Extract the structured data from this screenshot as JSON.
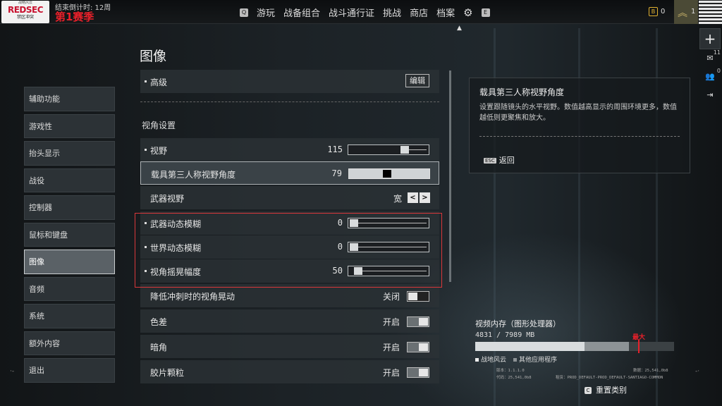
{
  "topbar": {
    "logo_top": "战略风云",
    "logo_main": "REDSEC",
    "logo_sub": "禁区冲突",
    "countdown": "结束倒计时: 12周",
    "season": "第1赛季",
    "nav_left_key": "Q",
    "nav_items": [
      "游玩",
      "战备组合",
      "战斗通行证",
      "挑战",
      "商店",
      "档案"
    ],
    "nav_right_key": "E",
    "currency_icon": "B",
    "currency_value": "0",
    "rank_value": "1"
  },
  "right_column": {
    "plus": "+",
    "mail_count": "11",
    "friends_count": "0"
  },
  "left_menu": [
    {
      "label": "辅助功能",
      "active": false
    },
    {
      "label": "游戏性",
      "active": false
    },
    {
      "label": "抬头显示",
      "active": false
    },
    {
      "label": "战役",
      "active": false
    },
    {
      "label": "控制器",
      "active": false
    },
    {
      "label": "鼠标和键盘",
      "active": false
    },
    {
      "label": "图像",
      "active": true
    },
    {
      "label": "音频",
      "active": false
    },
    {
      "label": "系统",
      "active": false
    },
    {
      "label": "额外内容",
      "active": false
    },
    {
      "label": "退出",
      "active": false
    }
  ],
  "page_title": "图像",
  "settings": {
    "advanced_label": "高级",
    "edit_label": "编辑",
    "section_header": "视角设置",
    "fov_label": "视野",
    "fov_value": "115",
    "fov_level": 0.73,
    "vehicle_fov_label": "载具第三人称视野角度",
    "vehicle_fov_value": "79",
    "vehicle_fov_level": 0.47,
    "weapon_fov_label": "武器视野",
    "weapon_fov_value": "宽",
    "weapon_blur_label": "武器动态模糊",
    "weapon_blur_value": "0",
    "world_blur_label": "世界动态模糊",
    "world_blur_value": "0",
    "camera_shake_label": "视角摇晃幅度",
    "camera_shake_value": "50",
    "sprint_shake_label": "降低冲刺时的视角晃动",
    "sprint_shake_value": "关闭",
    "chromatic_label": "色差",
    "chromatic_value": "开启",
    "vignette_label": "暗角",
    "vignette_value": "开启",
    "grain_label": "胶片颗粒",
    "grain_value": "开启"
  },
  "info_panel": {
    "title": "载具第三人称视野角度",
    "description": "设置跟随镜头的水平视野。数值越高显示的周围环境更多，数值越低则更聚焦和放大。",
    "esc_key": "ESC",
    "back_label": "返回"
  },
  "memory": {
    "title": "视频内存（图形处理器）",
    "usage": "4831 / 7989 MB",
    "max_label": "最大",
    "legend_bf": "战地风云",
    "legend_other": "其他应用程序",
    "version": "版本：1.1.1.0",
    "code": "代码：25,541,0b8",
    "data": "数据：25,541,0b8",
    "rental": "租赁：PROD_DEFAULT-PROD_DEFAULT-SANTIAGO-COMMON"
  },
  "reset": {
    "key": "C",
    "label": "重置类别"
  }
}
